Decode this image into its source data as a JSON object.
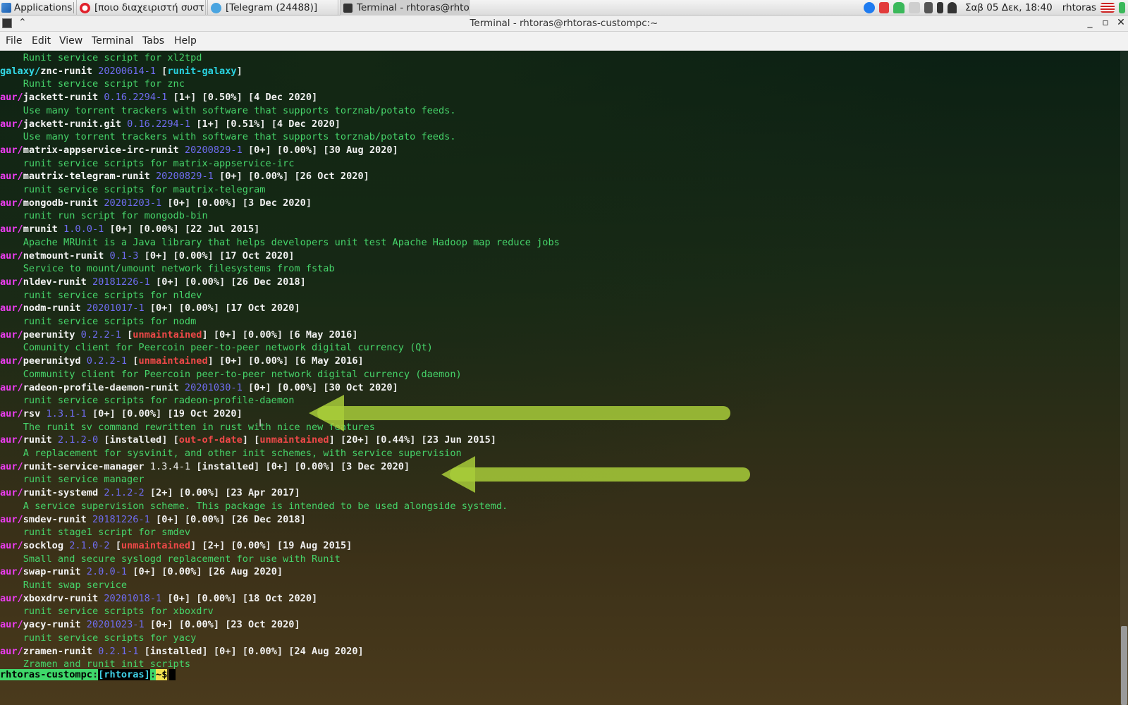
{
  "panel": {
    "applications_label": "Applications",
    "tasks": [
      {
        "label": "[ποιο διαχειριστή συστή...",
        "icon": "opera-icon"
      },
      {
        "label": "[Telegram (24488)]",
        "icon": "telegram-icon"
      },
      {
        "label": "Terminal - rhtoras@rhto...",
        "icon": "terminal-icon"
      }
    ],
    "tray_icons": [
      "messenger-icon",
      "notification-badge-icon",
      "ghost-icon",
      "network-icon",
      "volume-icon",
      "battery-icon",
      "bell-icon"
    ],
    "datetime": "Σαβ 05 Δεκ, 18:40",
    "user": "rhtoras"
  },
  "window": {
    "title": "Terminal - rhtoras@rhtoras-custompc:~",
    "controls": [
      "_",
      "▫",
      "✕"
    ]
  },
  "menu": [
    "File",
    "Edit",
    "View",
    "Terminal",
    "Tabs",
    "Help"
  ],
  "colors": {
    "repo_aur": "#ec3df0",
    "repo_galaxy": "#33d9e6",
    "version": "#6f6cf0",
    "description": "#46d46a",
    "warning": "#ee4848",
    "annotation_arrow": "#a8cc3a"
  },
  "terminal": {
    "entries": [
      {
        "desc": "Runit service script for xl2tpd"
      },
      {
        "repo": "galaxy/",
        "name": "znc-runit",
        "version": "20200614-1",
        "group": "runit-galaxy",
        "desc": "Runit service script for znc"
      },
      {
        "repo": "aur/",
        "name": "jackett-runit",
        "version": "0.16.2294-1",
        "votes": "1+",
        "pop": "0.50%",
        "date": "4 Dec 2020",
        "desc": "Use many torrent trackers with software that supports torznab/potato feeds."
      },
      {
        "repo": "aur/",
        "name": "jackett-runit.git",
        "version": "0.16.2294-1",
        "votes": "1+",
        "pop": "0.51%",
        "date": "4 Dec 2020",
        "desc": "Use many torrent trackers with software that supports torznab/potato feeds."
      },
      {
        "repo": "aur/",
        "name": "matrix-appservice-irc-runit",
        "version": "20200829-1",
        "votes": "0+",
        "pop": "0.00%",
        "date": "30 Aug 2020",
        "desc": "runit service scripts for matrix-appservice-irc"
      },
      {
        "repo": "aur/",
        "name": "mautrix-telegram-runit",
        "version": "20200829-1",
        "votes": "0+",
        "pop": "0.00%",
        "date": "26 Oct 2020",
        "desc": "runit service scripts for mautrix-telegram"
      },
      {
        "repo": "aur/",
        "name": "mongodb-runit",
        "version": "20201203-1",
        "votes": "0+",
        "pop": "0.00%",
        "date": "3 Dec 2020",
        "desc": "runit run script for mongodb-bin"
      },
      {
        "repo": "aur/",
        "name": "mrunit",
        "version": "1.0.0-1",
        "votes": "0+",
        "pop": "0.00%",
        "date": "22 Jul 2015",
        "desc": "Apache MRUnit is a Java library that helps developers unit test Apache Hadoop map reduce jobs"
      },
      {
        "repo": "aur/",
        "name": "netmount-runit",
        "version": "0.1-3",
        "votes": "0+",
        "pop": "0.00%",
        "date": "17 Oct 2020",
        "desc": "Service to mount/umount network filesystems from fstab"
      },
      {
        "repo": "aur/",
        "name": "nldev-runit",
        "version": "20181226-1",
        "votes": "0+",
        "pop": "0.00%",
        "date": "26 Dec 2018",
        "desc": "runit service scripts for nldev"
      },
      {
        "repo": "aur/",
        "name": "nodm-runit",
        "version": "20201017-1",
        "votes": "0+",
        "pop": "0.00%",
        "date": "17 Oct 2020",
        "desc": "runit service scripts for nodm"
      },
      {
        "repo": "aur/",
        "name": "peerunity",
        "version": "0.2.2-1",
        "flags": [
          "unmaintained"
        ],
        "votes": "0+",
        "pop": "0.00%",
        "date": "6 May 2016",
        "desc": "Comunity client for Peercoin peer-to-peer network digital currency (Qt)"
      },
      {
        "repo": "aur/",
        "name": "peerunityd",
        "version": "0.2.2-1",
        "flags": [
          "unmaintained"
        ],
        "votes": "0+",
        "pop": "0.00%",
        "date": "6 May 2016",
        "desc": "Community client for Peercoin peer-to-peer network digital currency (daemon)"
      },
      {
        "repo": "aur/",
        "name": "radeon-profile-daemon-runit",
        "version": "20201030-1",
        "votes": "0+",
        "pop": "0.00%",
        "date": "30 Oct 2020",
        "desc": "runit service scripts for radeon-profile-daemon"
      },
      {
        "repo": "aur/",
        "name": "rsv",
        "version": "1.3.1-1",
        "votes": "0+",
        "pop": "0.00%",
        "date": "19 Oct 2020",
        "desc": "The runit sv command rewritten in rust with nice new features"
      },
      {
        "repo": "aur/",
        "name": "runit",
        "version": "2.1.2-0",
        "installed": "installed",
        "flags": [
          "out-of-date",
          "unmaintained"
        ],
        "votes": "20+",
        "pop": "0.44%",
        "date": "23 Jun 2015",
        "desc": "A replacement for sysvinit, and other init schemes, with service supervision"
      },
      {
        "repo": "aur/",
        "name": "runit-service-manager",
        "version": "1.3.4-1",
        "version_plain": true,
        "installed": "installed",
        "votes": "0+",
        "pop": "0.00%",
        "date": "3 Dec 2020",
        "desc": "runit service manager"
      },
      {
        "repo": "aur/",
        "name": "runit-systemd",
        "version": "2.1.2-2",
        "votes": "2+",
        "pop": "0.00%",
        "date": "23 Apr 2017",
        "desc": "A service supervision scheme. This package is intended to be used alongside systemd."
      },
      {
        "repo": "aur/",
        "name": "smdev-runit",
        "version": "20181226-1",
        "votes": "0+",
        "pop": "0.00%",
        "date": "26 Dec 2018",
        "desc": "runit stage1 script for smdev"
      },
      {
        "repo": "aur/",
        "name": "socklog",
        "version": "2.1.0-2",
        "flags": [
          "unmaintained"
        ],
        "votes": "2+",
        "pop": "0.00%",
        "date": "19 Aug 2015",
        "desc": "Small and secure syslogd replacement for use with Runit"
      },
      {
        "repo": "aur/",
        "name": "swap-runit",
        "version": "2.0.0-1",
        "votes": "0+",
        "pop": "0.00%",
        "date": "26 Aug 2020",
        "desc": "Runit swap service"
      },
      {
        "repo": "aur/",
        "name": "xboxdrv-runit",
        "version": "20201018-1",
        "votes": "0+",
        "pop": "0.00%",
        "date": "18 Oct 2020",
        "desc": "runit service scripts for xboxdrv"
      },
      {
        "repo": "aur/",
        "name": "yacy-runit",
        "version": "20201023-1",
        "votes": "0+",
        "pop": "0.00%",
        "date": "23 Oct 2020",
        "desc": "runit service scripts for yacy"
      },
      {
        "repo": "aur/",
        "name": "zramen-runit",
        "version": "0.2.1-1",
        "installed": "installed",
        "votes": "0+",
        "pop": "0.00%",
        "date": "24 Aug 2020",
        "desc": "Zramen and runit init scripts"
      }
    ],
    "prompt": {
      "host": "rhtoras-custompc",
      "user": "rhtoras",
      "cwd": "~",
      "symbol": "$"
    }
  }
}
